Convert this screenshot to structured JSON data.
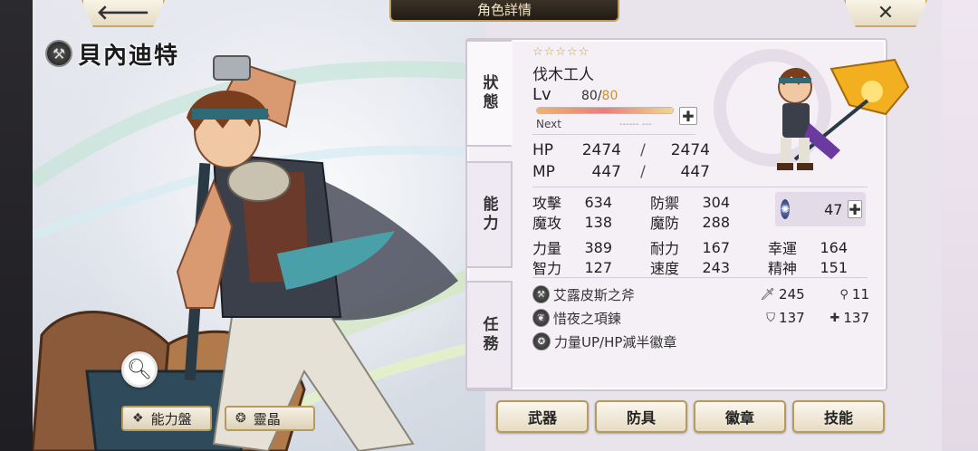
{
  "header": {
    "title": "角色詳情",
    "back_icon": "arrow-left-icon",
    "close_icon": "close-icon"
  },
  "character": {
    "name": "貝內迪特",
    "rarity_stars": "☆☆☆☆☆",
    "job": "伐木工人",
    "level_label": "Lv",
    "level_current": "80/",
    "level_max": "80",
    "exp_progress": 1.0,
    "next_label": "Next",
    "next_value": "------ ---"
  },
  "tabs": {
    "status": "狀態",
    "ability": "能力",
    "mission": "任務"
  },
  "vitals": {
    "hp_label": "HP",
    "hp_current": "2474",
    "hp_sep": "/",
    "hp_max": "2474",
    "mp_label": "MP",
    "mp_current": "447",
    "mp_sep": "/",
    "mp_max": "447"
  },
  "stats": {
    "atk_label": "攻擊",
    "atk": "634",
    "def_label": "防禦",
    "def": "304",
    "matk_label": "魔攻",
    "matk": "138",
    "mdef_label": "魔防",
    "mdef": "288",
    "str_label": "力量",
    "str": "389",
    "vit_label": "耐力",
    "vit": "167",
    "luck_label": "幸運",
    "luck": "164",
    "int_label": "智力",
    "int": "127",
    "spd_label": "速度",
    "spd": "243",
    "spr_label": "精神",
    "spr": "151"
  },
  "element": {
    "icon": "swirl-element-icon",
    "value": "47"
  },
  "equipment": [
    {
      "name": "艾露皮斯之斧",
      "stat1": "245",
      "stat1_icon": "sword-icon",
      "stat2": "11",
      "stat2_icon": "wand-icon"
    },
    {
      "name": "惜夜之項鍊",
      "stat1": "137",
      "stat1_icon": "shield-icon",
      "stat2": "137",
      "stat2_icon": "cross-shield-icon"
    },
    {
      "name": "力量UP/HP減半徽章"
    }
  ],
  "left_buttons": {
    "ability_board": "能力盤",
    "spirit_crystal": "靈晶"
  },
  "bottom_buttons": {
    "weapon": "武器",
    "armor": "防具",
    "badge": "徽章",
    "skill": "技能"
  }
}
